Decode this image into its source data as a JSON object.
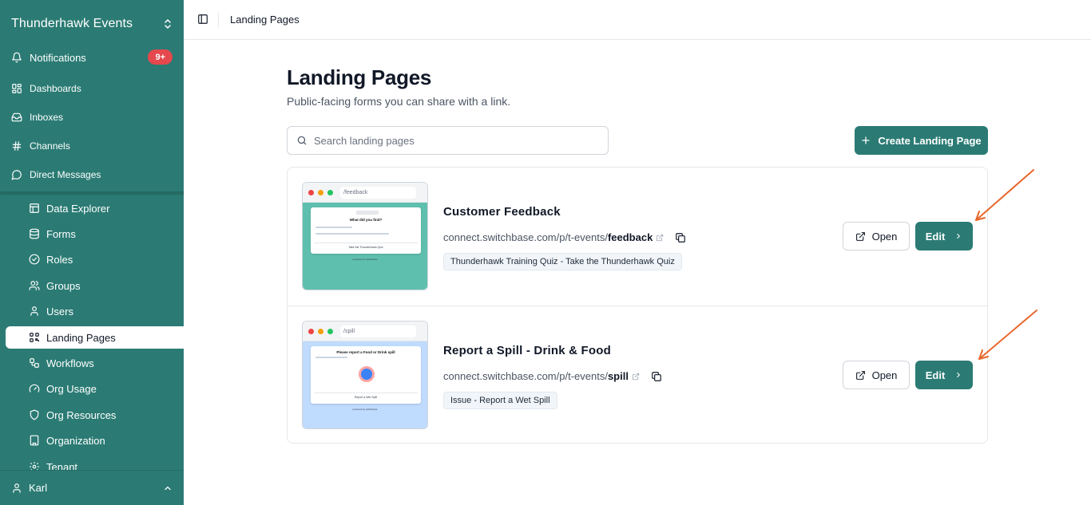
{
  "workspace": {
    "name": "Thunderhawk Events"
  },
  "sidebar": {
    "top_items": [
      {
        "label": "Notifications",
        "icon": "bell-icon",
        "badge": "9+"
      },
      {
        "label": "Dashboards",
        "icon": "dashboard-icon"
      },
      {
        "label": "Inboxes",
        "icon": "inbox-icon"
      },
      {
        "label": "Channels",
        "icon": "hash-icon"
      },
      {
        "label": "Direct Messages",
        "icon": "message-icon"
      }
    ],
    "section_items": [
      {
        "label": "Data Explorer",
        "icon": "table-icon"
      },
      {
        "label": "Forms",
        "icon": "database-icon"
      },
      {
        "label": "Roles",
        "icon": "check-circle-icon"
      },
      {
        "label": "Groups",
        "icon": "users-icon"
      },
      {
        "label": "Users",
        "icon": "user-icon"
      },
      {
        "label": "Landing Pages",
        "icon": "qr-code-icon",
        "active": true
      },
      {
        "label": "Workflows",
        "icon": "workflow-icon"
      },
      {
        "label": "Org Usage",
        "icon": "gauge-icon"
      },
      {
        "label": "Org Resources",
        "icon": "shield-icon"
      },
      {
        "label": "Organization",
        "icon": "building-icon"
      },
      {
        "label": "Tenant",
        "icon": "settings-icon"
      }
    ],
    "user": {
      "name": "Karl"
    }
  },
  "topbar": {
    "title": "Landing Pages"
  },
  "page": {
    "title": "Landing Pages",
    "subtitle": "Public-facing forms you can share with a link.",
    "search_placeholder": "Search landing pages",
    "create_label": "Create Landing Page"
  },
  "landing_pages": [
    {
      "name": "Customer Feedback",
      "link_prefix": "connect.switchbase.com/p/t-events/",
      "slug": "feedback",
      "tag": "Thunderhawk Training Quiz - Take the Thunderhawk Quiz",
      "preview": {
        "url": "/feedback",
        "color": "#5fbfae",
        "title": "What did you find?"
      },
      "open_label": "Open",
      "edit_label": "Edit"
    },
    {
      "name": "Report a Spill - Drink & Food",
      "link_prefix": "connect.switchbase.com/p/t-events/",
      "slug": "spill",
      "tag": "Issue - Report a Wet Spill",
      "preview": {
        "url": "/spill",
        "color": "#bfdbfe",
        "title": "Please report a Food or Drink spill"
      },
      "open_label": "Open",
      "edit_label": "Edit"
    }
  ],
  "colors": {
    "brand": "#2b7b74",
    "badge": "#e5484d",
    "annotation_arrow": "#e8672b"
  }
}
